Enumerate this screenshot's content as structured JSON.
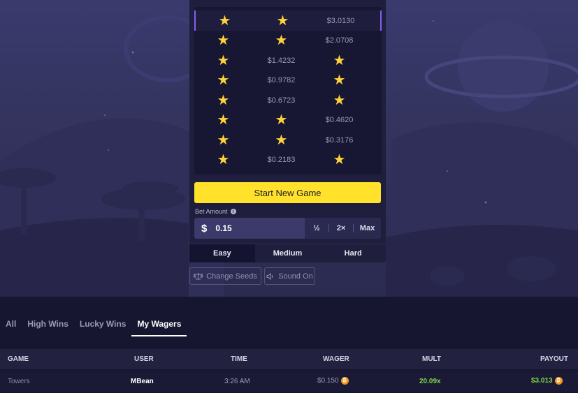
{
  "grid": {
    "rows": [
      {
        "cells": [
          "star",
          "star",
          "$3.0130"
        ],
        "active": true
      },
      {
        "cells": [
          "star",
          "star",
          "$2.0708"
        ],
        "active": false
      },
      {
        "cells": [
          "star",
          "$1.4232",
          "star"
        ],
        "active": false
      },
      {
        "cells": [
          "star",
          "$0.9782",
          "star"
        ],
        "active": false
      },
      {
        "cells": [
          "star",
          "$0.6723",
          "star"
        ],
        "active": false
      },
      {
        "cells": [
          "star",
          "star",
          "$0.4620"
        ],
        "active": false
      },
      {
        "cells": [
          "star",
          "star",
          "$0.3176"
        ],
        "active": false
      },
      {
        "cells": [
          "star",
          "$0.2183",
          "star"
        ],
        "active": false
      }
    ]
  },
  "controls": {
    "start_label": "Start New Game",
    "bet_label": "Bet Amount",
    "currency_symbol": "$",
    "bet_value": "0.15",
    "half_label": "½",
    "double_label": "2×",
    "max_label": "Max"
  },
  "difficulty": {
    "tabs": [
      "Easy",
      "Medium",
      "Hard"
    ],
    "selected": "Easy"
  },
  "tools": {
    "change_seeds": "Change Seeds",
    "sound": "Sound On"
  },
  "feed_tabs": {
    "items": [
      "All",
      "High Wins",
      "Lucky Wins",
      "My Wagers"
    ],
    "selected": "My Wagers"
  },
  "table": {
    "headers": {
      "game": "GAME",
      "user": "USER",
      "time": "TIME",
      "wager": "WAGER",
      "mult": "MULT",
      "payout": "PAYOUT"
    },
    "rows": [
      {
        "game": "Towers",
        "user": "MBean",
        "time": "3:26 AM",
        "wager": "$0.150",
        "mult": "20.09x",
        "payout": "$3.013"
      }
    ]
  },
  "colors": {
    "accent_yellow": "#ffe229",
    "star": "#ffd23a",
    "win_green": "#7cd64a",
    "coin": "#f39a1f",
    "active_row_border": "#8a5cf0"
  }
}
